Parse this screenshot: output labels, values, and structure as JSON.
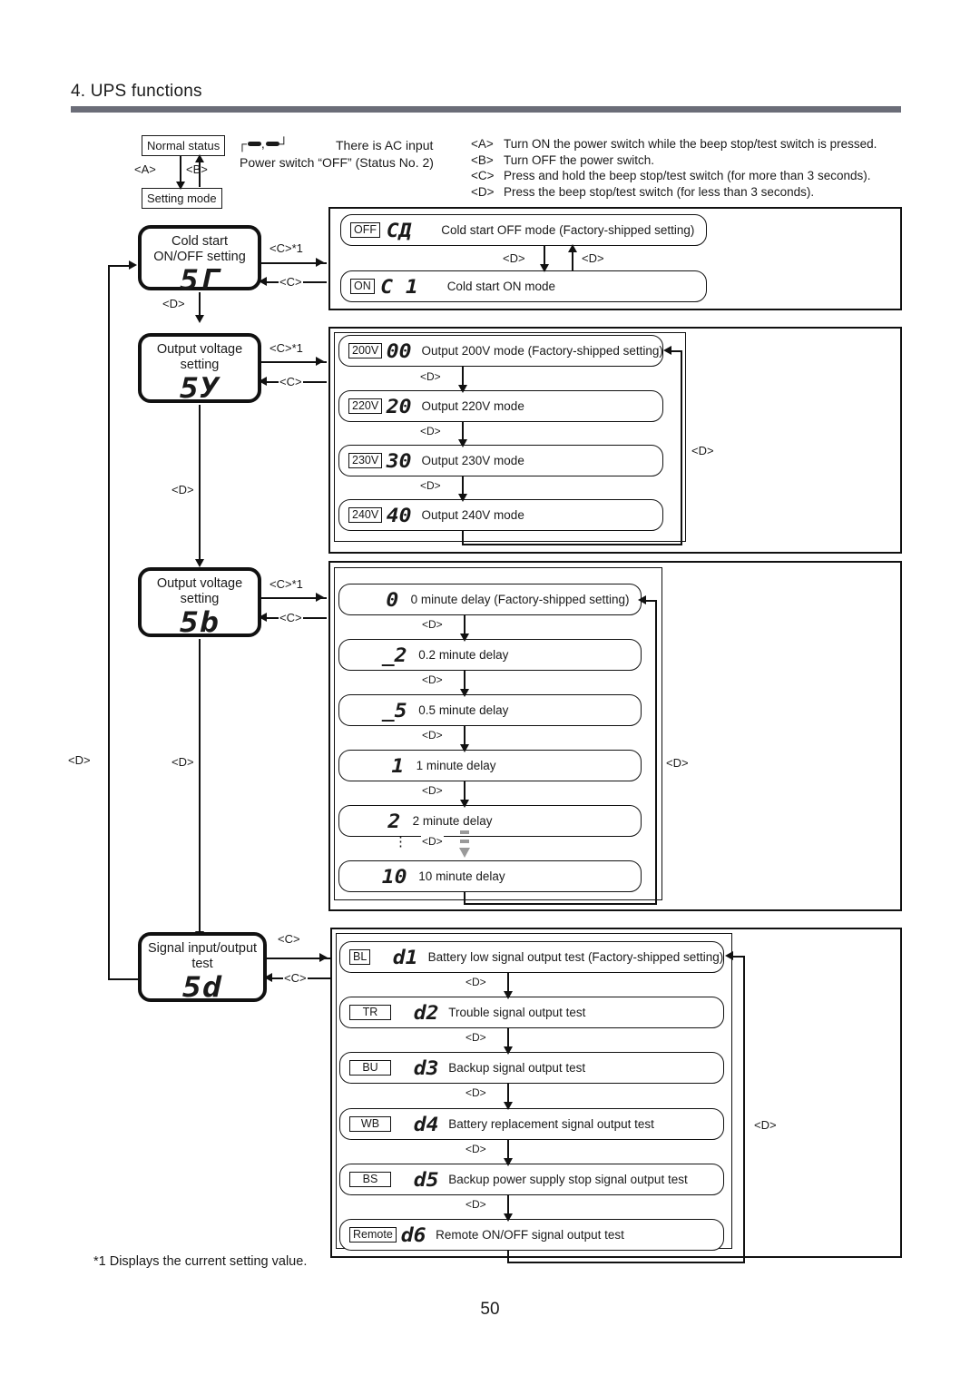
{
  "header": {
    "title": "4. UPS functions"
  },
  "top_legend": {
    "normal_status": "Normal status",
    "setting_mode": "Setting mode",
    "transition_a": "<A>",
    "transition_b": "<B>",
    "ac_symbol_open": "┌",
    "ac_symbol_comma": ",",
    "ac_symbol_close": "┘",
    "ac_input_text": "There is AC input",
    "power_switch_text": "Power switch “OFF” (Status No. 2)",
    "operations": [
      {
        "key": "<A>",
        "text": "Turn ON the power switch while the beep stop/test switch is pressed."
      },
      {
        "key": "<B>",
        "text": "Turn OFF the power switch."
      },
      {
        "key": "<C>",
        "text": "Press and hold the beep stop/test switch (for more than 3 seconds)."
      },
      {
        "key": "<D>",
        "text": "Press the beep stop/test switch (for less than 3 seconds)."
      }
    ]
  },
  "labels": {
    "c_star": "<C>*1",
    "c": "<C>",
    "d": "<D>"
  },
  "sections": [
    {
      "state_title": "Cold start\nON/OFF setting",
      "state_code": "5Г",
      "enter_label": "<C>*1",
      "exit_label": "<C>",
      "next_label": "<D>",
      "options": [
        {
          "tag": "OFF",
          "code": "СД",
          "text": "Cold start OFF mode (Factory-shipped setting)"
        },
        {
          "tag": "ON",
          "code": "С 1",
          "text": "Cold start ON mode"
        }
      ]
    },
    {
      "state_title": "Output voltage\nsetting",
      "state_code": "5У",
      "enter_label": "<C>*1",
      "exit_label": "<C>",
      "next_label": "<D>",
      "loop_label": "<D>",
      "options": [
        {
          "tag": "200V",
          "code": "00",
          "text": "Output 200V mode (Factory-shipped setting)"
        },
        {
          "tag": "220V",
          "code": "20",
          "text": "Output 220V mode"
        },
        {
          "tag": "230V",
          "code": "30",
          "text": "Output 230V mode"
        },
        {
          "tag": "240V",
          "code": "40",
          "text": "Output 240V mode"
        }
      ]
    },
    {
      "state_title": "Output voltage\nsetting",
      "state_code": "5b",
      "enter_label": "<C>*1",
      "exit_label": "<C>",
      "next_label": "<D>",
      "loop_label": "<D>",
      "options": [
        {
          "tag": "",
          "code": "0",
          "text": "0 minute delay (Factory-shipped setting)"
        },
        {
          "tag": "",
          "code": "_2",
          "text": "0.2 minute delay"
        },
        {
          "tag": "",
          "code": "_5",
          "text": "0.5 minute delay"
        },
        {
          "tag": "",
          "code": "1",
          "text": "1 minute delay"
        },
        {
          "tag": "",
          "code": "2",
          "text": "2 minute delay"
        },
        {
          "tag": "",
          "code": "10",
          "text": "10 minute delay"
        }
      ]
    },
    {
      "state_title": "Signal input/output\ntest",
      "state_code": "5d",
      "enter_label": "<C>",
      "exit_label": "<C>",
      "loop_label": "<D>",
      "options": [
        {
          "tag": "BL",
          "code": "d1",
          "text": "Battery low signal output test (Factory-shipped setting)"
        },
        {
          "tag": "TR",
          "code": "d2",
          "text": "Trouble signal output test"
        },
        {
          "tag": "BU",
          "code": "d3",
          "text": "Backup signal output test"
        },
        {
          "tag": "WB",
          "code": "d4",
          "text": "Battery replacement signal output test"
        },
        {
          "tag": "BS",
          "code": "d5",
          "text": "Backup power supply stop signal output test"
        },
        {
          "tag": "Remote",
          "code": "d6",
          "text": "Remote ON/OFF signal output test"
        }
      ]
    }
  ],
  "return_rail_label": "<D>",
  "footnote": "*1 Displays the current setting value.",
  "page_number": "50"
}
